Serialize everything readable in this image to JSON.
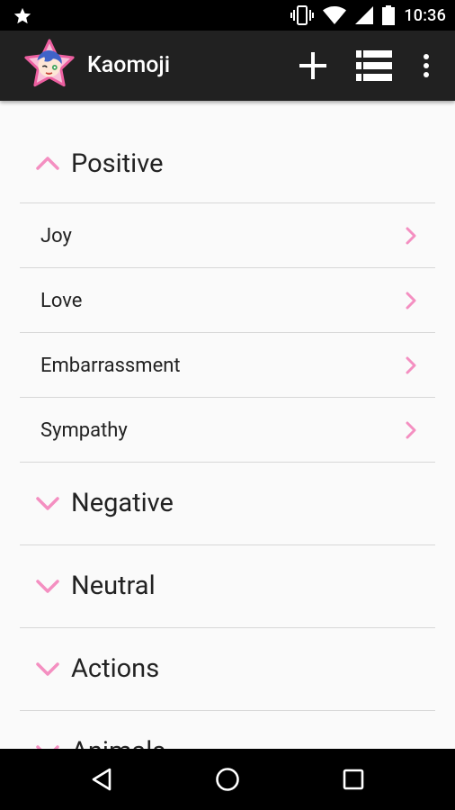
{
  "status_bar": {
    "time": "10:36",
    "icons": [
      "star-icon",
      "vibrate-icon",
      "wifi-icon",
      "signal-icon",
      "battery-icon"
    ]
  },
  "app_bar": {
    "title": "Kaomoji",
    "logo": "kaomoji-star-logo",
    "actions": [
      "add-icon",
      "list-view-icon",
      "more-vert-icon"
    ]
  },
  "accent_color": "#f48fc1",
  "categories": [
    {
      "label": "Positive",
      "expanded": true,
      "items": [
        "Joy",
        "Love",
        "Embarrassment",
        "Sympathy"
      ]
    },
    {
      "label": "Negative",
      "expanded": false
    },
    {
      "label": "Neutral",
      "expanded": false
    },
    {
      "label": "Actions",
      "expanded": false
    },
    {
      "label": "Animals",
      "expanded": false
    }
  ],
  "nav_bar": {
    "buttons": [
      "back-icon",
      "home-icon",
      "recents-icon"
    ]
  }
}
